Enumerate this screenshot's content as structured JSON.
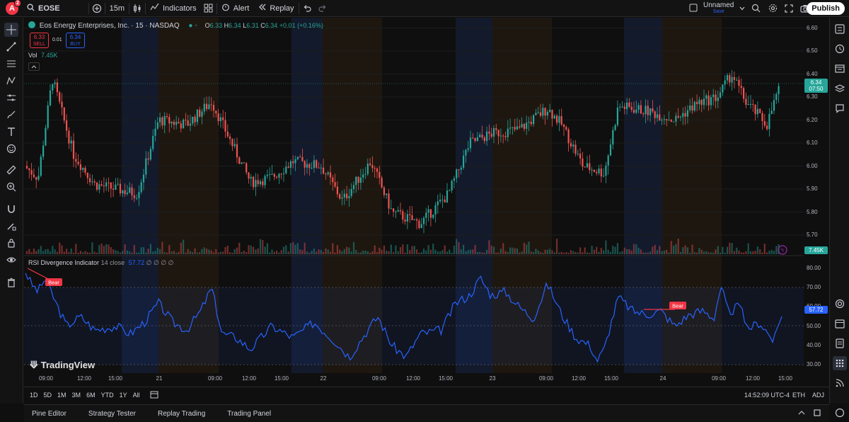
{
  "topbar": {
    "avatar_letter": "A",
    "avatar_badge": "2",
    "symbol": "EOSE",
    "interval": "15m",
    "indicators_label": "Indicators",
    "alert_label": "Alert",
    "replay_label": "Replay",
    "layout_name": "Unnamed",
    "layout_status": "Save",
    "publish_label": "Publish"
  },
  "legend": {
    "title": "Eos Energy Enterprises, Inc. · 15 · NASDAQ",
    "o_label": "O",
    "o_value": "6.33",
    "h_label": "H",
    "h_value": "6.34",
    "l_label": "L",
    "l_value": "6.31",
    "c_label": "C",
    "c_value": "6.34",
    "change": "+0.01 (+0.16%)",
    "sell_price": "6.33",
    "sell_label": "SELL",
    "spread": "0.01",
    "buy_price": "6.34",
    "buy_label": "BUY",
    "vol_label": "Vol",
    "vol_value": "7.45K"
  },
  "rsi_legend": {
    "name": "RSI Divergence Indicator",
    "params": "14 close",
    "value": "57.72",
    "extras": "∅ ∅ ∅ ∅"
  },
  "bear_label": "Bear",
  "price_axis": {
    "labels": [
      "6.60",
      "6.50",
      "6.40",
      "6.30",
      "6.20",
      "6.10",
      "6.00",
      "5.90",
      "5.80",
      "5.70"
    ],
    "current_price": "6.34",
    "countdown": "07:50",
    "volume_tag": "7.45K"
  },
  "rsi_axis": {
    "labels": [
      "80.00",
      "70.00",
      "60.00",
      "50.00",
      "40.00",
      "30.00"
    ],
    "current": "57.72"
  },
  "time_axis": [
    "09:00",
    "12:00",
    "15:00",
    "21",
    "09:00",
    "12:00",
    "15:00",
    "22",
    "09:00",
    "12:00",
    "15:00",
    "23",
    "09:00",
    "12:00",
    "15:00",
    "24",
    "09:00",
    "12:00",
    "15:00"
  ],
  "range_bar": {
    "ranges": [
      "1D",
      "5D",
      "1M",
      "3M",
      "6M",
      "YTD",
      "1Y",
      "All"
    ],
    "clock": "14:52:09 UTC-4",
    "session": "ETH",
    "adj": "ADJ"
  },
  "bottom_tabs": [
    "Pine Editor",
    "Strategy Tester",
    "Replay Trading",
    "Trading Panel"
  ],
  "watermark": "TradingView",
  "colors": {
    "up": "#26a69a",
    "down": "#ef5350",
    "rsi": "#2962ff",
    "session_blue": "#131a2b",
    "session_orange": "#1e1710"
  },
  "chart_data": {
    "type": "candlestick",
    "price_range": [
      5.66,
      6.62
    ],
    "rsi_range": [
      27,
      82
    ],
    "rsi_band": [
      30,
      70
    ],
    "rsi_mid": 50,
    "last_price": 6.34,
    "last_rsi": 57.72
  }
}
